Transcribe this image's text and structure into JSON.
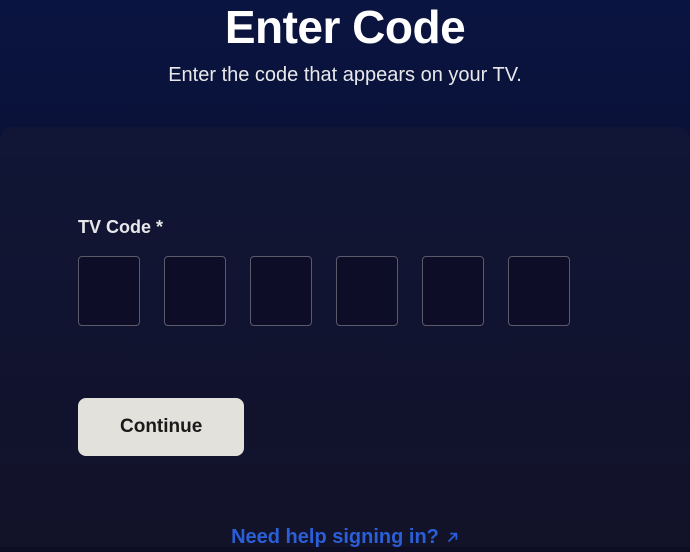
{
  "header": {
    "title": "Enter Code",
    "subtitle": "Enter the code that appears on your TV."
  },
  "form": {
    "field_label": "TV Code *",
    "code_values": [
      "",
      "",
      "",
      "",
      "",
      ""
    ],
    "continue_label": "Continue"
  },
  "footer": {
    "help_link_text": "Need help signing in?"
  }
}
